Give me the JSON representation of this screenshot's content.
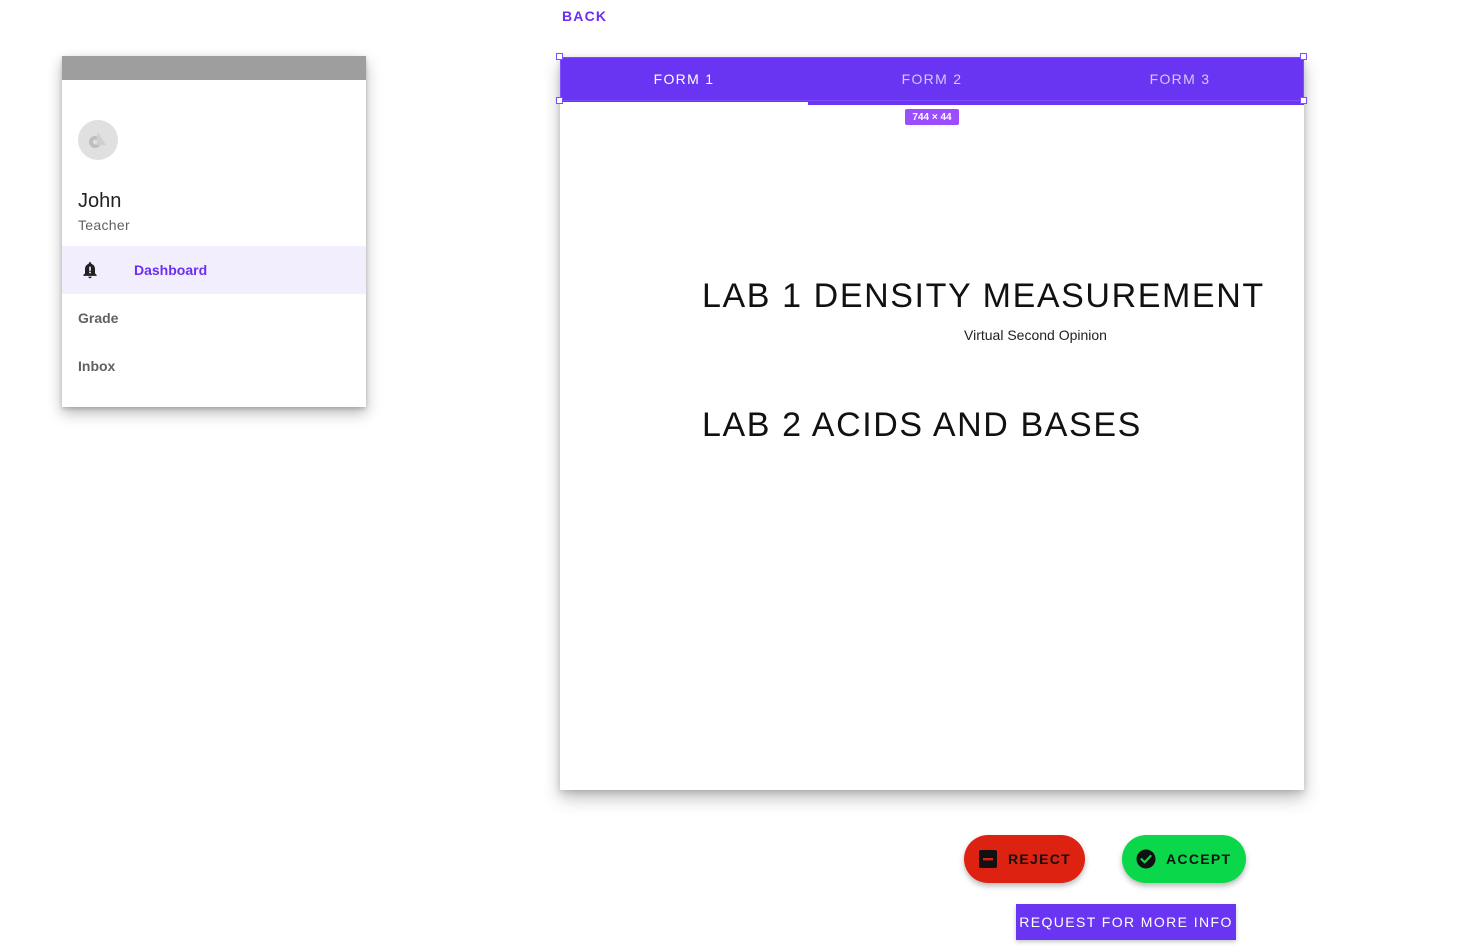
{
  "nav": {
    "back_label": "BACK"
  },
  "drawer": {
    "user": {
      "name": "John",
      "role": "Teacher"
    },
    "items": [
      {
        "label": "Dashboard",
        "icon": "bell-alert-icon",
        "active": true
      },
      {
        "label": "Grade",
        "active": false
      },
      {
        "label": "Inbox",
        "active": false
      }
    ]
  },
  "tabs": [
    {
      "label": "FORM 1",
      "active": true
    },
    {
      "label": "FORM 2",
      "active": false
    },
    {
      "label": "FORM 3",
      "active": false
    }
  ],
  "selection_badge": "744 × 44",
  "content": {
    "lab1_title": "LAB 1 DENSITY MEASUREMENT",
    "lab1_subtitle": "Virtual Second Opinion",
    "lab2_title": "LAB 2 ACIDS AND BASES"
  },
  "actions": {
    "reject_label": "REJECT",
    "accept_label": "ACCEPT",
    "more_info_label": "REQUEST FOR MORE INFO"
  },
  "colors": {
    "primary": "#6a35f2",
    "reject": "#dd2211",
    "accept": "#0bd74a"
  }
}
